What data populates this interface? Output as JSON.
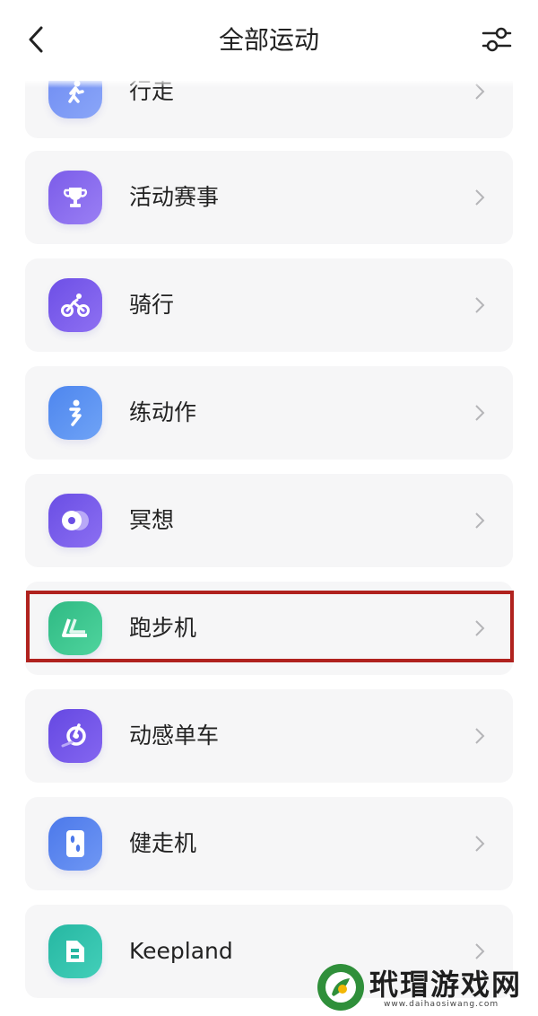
{
  "header": {
    "title": "全部运动"
  },
  "items": [
    {
      "label": "行走",
      "icon": "walk-icon",
      "colors": [
        "#6f8cf3",
        "#8aa6f8"
      ]
    },
    {
      "label": "活动赛事",
      "icon": "trophy-icon",
      "colors": [
        "#7b5ce9",
        "#9a7ff4"
      ]
    },
    {
      "label": "骑行",
      "icon": "cycling-icon",
      "colors": [
        "#6d4fe6",
        "#8e70f2"
      ]
    },
    {
      "label": "练动作",
      "icon": "exercise-icon",
      "colors": [
        "#4e86ee",
        "#6fa3f6"
      ]
    },
    {
      "label": "冥想",
      "icon": "meditation-icon",
      "colors": [
        "#6a4ee4",
        "#8b6ff2"
      ]
    },
    {
      "label": "跑步机",
      "icon": "treadmill-icon",
      "colors": [
        "#2fba84",
        "#4fd49d"
      ]
    },
    {
      "label": "动感单车",
      "icon": "spin-bike-icon",
      "colors": [
        "#6548e2",
        "#8466f0"
      ]
    },
    {
      "label": "健走机",
      "icon": "walking-pad-icon",
      "colors": [
        "#4c79ea",
        "#6f97f4"
      ]
    },
    {
      "label": "Keepland",
      "icon": "keepland-icon",
      "colors": [
        "#26b7a2",
        "#43cfb9"
      ]
    }
  ],
  "watermark": {
    "name": "玳瑁游戏网",
    "url": "www.daihaosiwang.com"
  }
}
